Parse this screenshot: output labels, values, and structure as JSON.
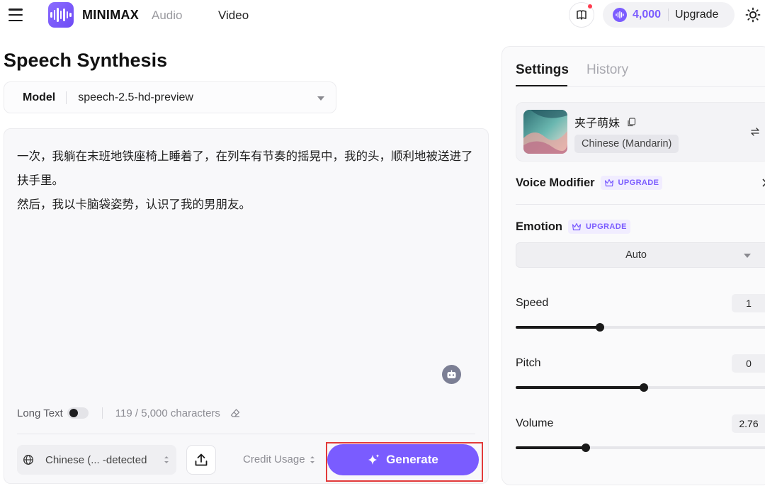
{
  "topbar": {
    "brand": "MINIMAX",
    "nav_audio": "Audio",
    "nav_video": "Video",
    "credits": "4,000",
    "upgrade_label": "Upgrade"
  },
  "main": {
    "title": "Speech Synthesis",
    "model_label": "Model",
    "model_value": "speech-2.5-hd-preview",
    "text": "一次，我躺在末班地铁座椅上睡着了，在列车有节奏的摇晃中，我的头，顺利地被送进了扶手里。\n然后，我以卡脑袋姿势，认识了我的男朋友。",
    "long_text_label": "Long Text",
    "long_text_enabled": false,
    "char_count": "119 / 5,000 characters",
    "language_select": "Chinese (...  -detected",
    "credit_usage_label": "Credit Usage",
    "generate_label": "Generate"
  },
  "panel": {
    "tabs": [
      {
        "label": "Settings",
        "active": true
      },
      {
        "label": "History",
        "active": false
      }
    ],
    "voice": {
      "name": "夹子萌妹",
      "language_tag": "Chinese (Mandarin)"
    },
    "voice_modifier_label": "Voice Modifier",
    "upgrade_badge": "UPGRADE",
    "emotion_label": "Emotion",
    "emotion_value": "Auto",
    "speed": {
      "label": "Speed",
      "value": "1",
      "fraction": 0.33
    },
    "pitch": {
      "label": "Pitch",
      "value": "0",
      "fraction": 0.5
    },
    "volume": {
      "label": "Volume",
      "value": "2.76",
      "fraction": 0.275
    }
  },
  "colors": {
    "accent": "#7a5cff",
    "highlight_outline": "#e23a3a"
  }
}
